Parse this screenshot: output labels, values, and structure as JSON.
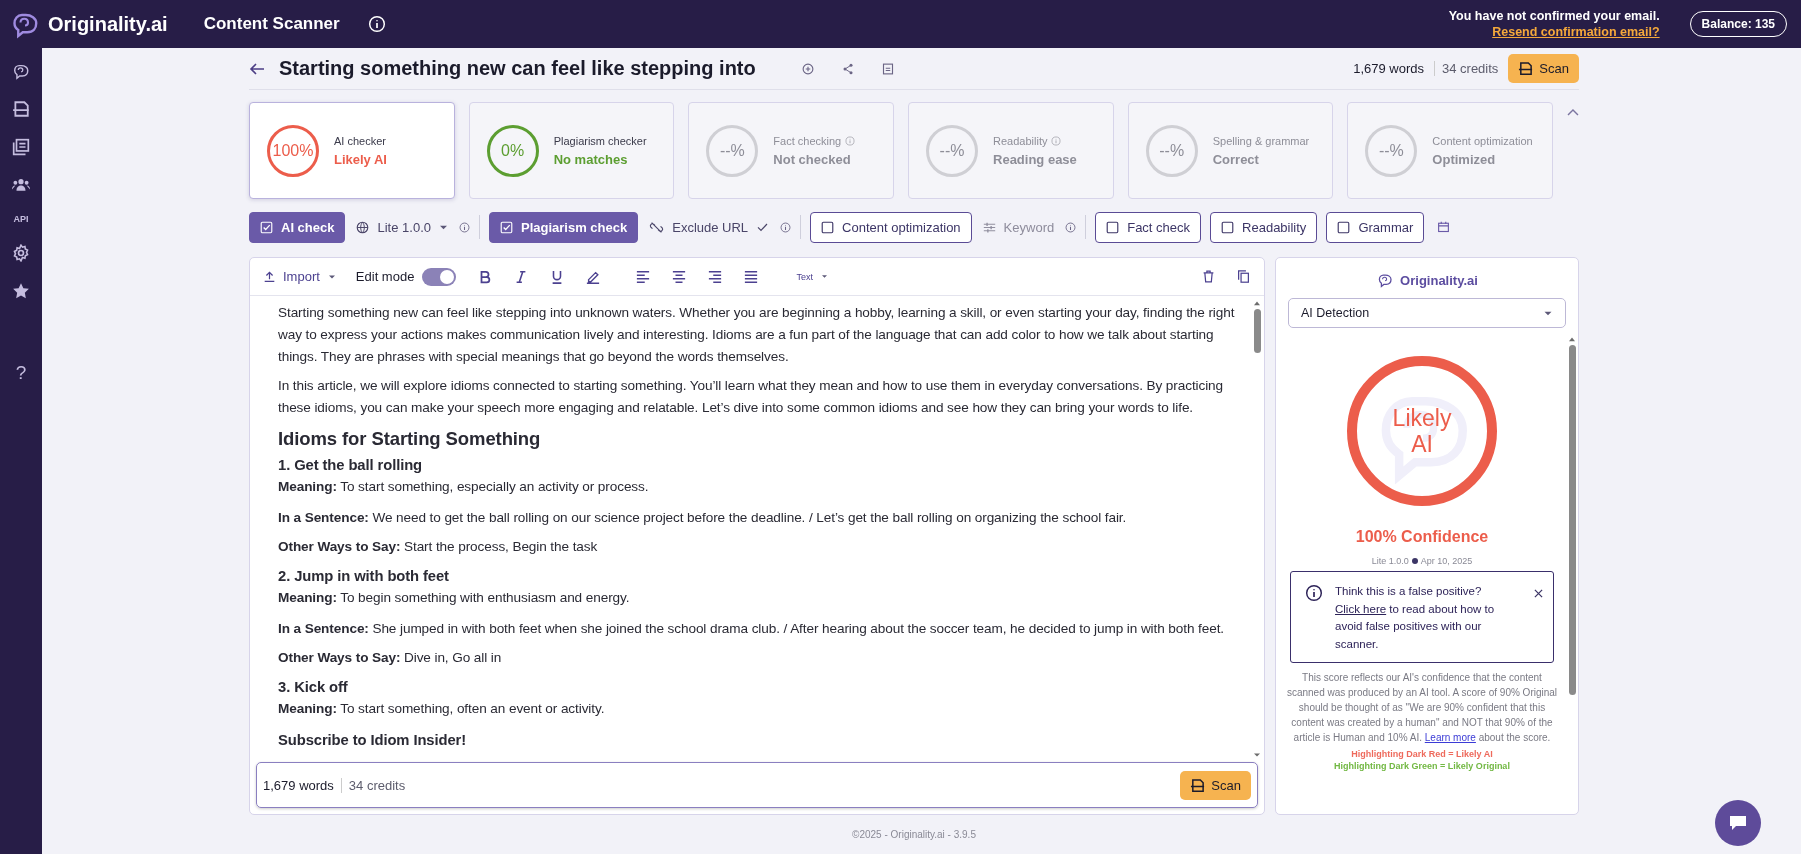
{
  "header": {
    "brand": "Originality.ai",
    "product": "Content Scanner",
    "notice": "You have not confirmed your email.",
    "notice_link": "Resend confirmation email?",
    "balance": "Balance: 135"
  },
  "sidebar": {
    "api_label": "API",
    "help_label": "?"
  },
  "document": {
    "title": "Starting something new can feel like stepping into",
    "words": "1,679 words",
    "credits": "34 credits",
    "scan": "Scan"
  },
  "cards": [
    {
      "label": "AI checker",
      "value": "100%",
      "result": "Likely AI",
      "color": "#ec5d4b",
      "disabled": false,
      "info": false,
      "selected": true
    },
    {
      "label": "Plagiarism checker",
      "value": "0%",
      "result": "No matches",
      "color": "#5c9e31",
      "disabled": false,
      "info": false,
      "selected": false
    },
    {
      "label": "Fact checking",
      "value": "--%",
      "result": "Not checked",
      "color": "#cfcfd4",
      "disabled": true,
      "info": true,
      "selected": false
    },
    {
      "label": "Readability",
      "value": "--%",
      "result": "Reading ease",
      "color": "#cfcfd4",
      "disabled": true,
      "info": true,
      "selected": false
    },
    {
      "label": "Spelling & grammar",
      "value": "--%",
      "result": "Correct",
      "color": "#cfcfd4",
      "disabled": true,
      "info": false,
      "selected": false
    },
    {
      "label": "Content optimization",
      "value": "--%",
      "result": "Optimized",
      "color": "#cfcfd4",
      "disabled": true,
      "info": false,
      "selected": false
    }
  ],
  "option_groups": [
    [
      {
        "kind": "toggle",
        "label": "AI check",
        "checked": true
      },
      {
        "kind": "select",
        "label": "Lite 1.0.0",
        "info": true
      }
    ],
    [
      {
        "kind": "toggle",
        "label": "Plagiarism check",
        "checked": true
      },
      {
        "kind": "exclude",
        "label": "Exclude URL",
        "info": true
      }
    ],
    [
      {
        "kind": "toggle",
        "label": "Content optimization",
        "checked": false
      },
      {
        "kind": "keyword",
        "label": "Keyword",
        "info": true
      }
    ],
    [
      {
        "kind": "toggle",
        "label": "Fact check",
        "checked": false
      },
      {
        "kind": "toggle",
        "label": "Readability",
        "checked": false
      },
      {
        "kind": "toggle",
        "label": "Grammar",
        "checked": false
      },
      {
        "kind": "calendar"
      }
    ]
  ],
  "editor": {
    "import": "Import",
    "edit_mode": "Edit mode",
    "edit_on": true,
    "style": "Text",
    "blocks": [
      {
        "kind": "p",
        "text": "Starting something new can feel like stepping into unknown waters. Whether you are beginning a hobby, learning a skill, or even starting your day, finding the right way to express your actions makes communication lively and interesting. Idioms are a fun part of the language that can add color to how we talk about starting things. They are phrases with special meanings that go beyond the words themselves."
      },
      {
        "kind": "p",
        "text": "In this article, we will explore idioms connected to starting something. You’ll learn what they mean and how to use them in everyday conversations. By practicing these idioms, you can make your speech more engaging and relatable. Let’s dive into some common idioms and see how they can bring your words to life."
      },
      {
        "kind": "h2",
        "text": "Idioms for Starting Something"
      },
      {
        "kind": "h3",
        "text": "1. Get the ball rolling"
      },
      {
        "kind": "lead",
        "text": "**Meaning:** To start something, especially an activity or process."
      },
      {
        "kind": "p",
        "text": "**In a Sentence:** We need to get the ball rolling on our science project before the deadline. / Let’s get the ball rolling on organizing the school fair."
      },
      {
        "kind": "p",
        "text": "**Other Ways to Say:** Start the process, Begin the task"
      },
      {
        "kind": "h3",
        "text": "2. Jump in with both feet"
      },
      {
        "kind": "lead",
        "text": "**Meaning:** To begin something with enthusiasm and energy."
      },
      {
        "kind": "p",
        "text": "**In a Sentence:** She jumped in with both feet when she joined the school drama club. / After hearing about the soccer team, he decided to jump in with both feet."
      },
      {
        "kind": "p",
        "text": "**Other Ways to Say:** Dive in, Go all in"
      },
      {
        "kind": "h3",
        "text": "3. Kick off"
      },
      {
        "kind": "lead",
        "text": "**Meaning:** To start something, often an event or activity."
      },
      {
        "kind": "sub",
        "text": "Subscribe to Idiom Insider!"
      }
    ],
    "words": "1,679 words",
    "credits": "34 credits",
    "scan": "Scan"
  },
  "result_panel": {
    "brand": "Originality.ai",
    "mode": "AI Detection",
    "verdict": "Likely AI",
    "color": "#ec5d4b",
    "confidence": "100% Confidence",
    "model": "Lite 1.0.0",
    "date": "Apr 10, 2025",
    "notice": {
      "text": "Think this is a false positive?",
      "link": "Click here",
      "rest": "to read about how to avoid false positives with our scanner."
    },
    "explanation": "This score reflects our AI's confidence that the content scanned was produced by an AI tool. A score of 90% Original should be thought of as \"We are 90% confident that this content was created by a human\" and NOT that 90% of the article is Human and 10% AI.",
    "learn_more": "Learn more",
    "explanation_end": "about the score.",
    "legend": [
      {
        "text": "Highlighting Dark Red = Likely AI",
        "color": "#ee6a5c"
      },
      {
        "text": "Highlighting Dark Green = Likely Original",
        "color": "#72b843"
      }
    ]
  },
  "footer": "©2025 - Originality.ai - 3.9.5"
}
